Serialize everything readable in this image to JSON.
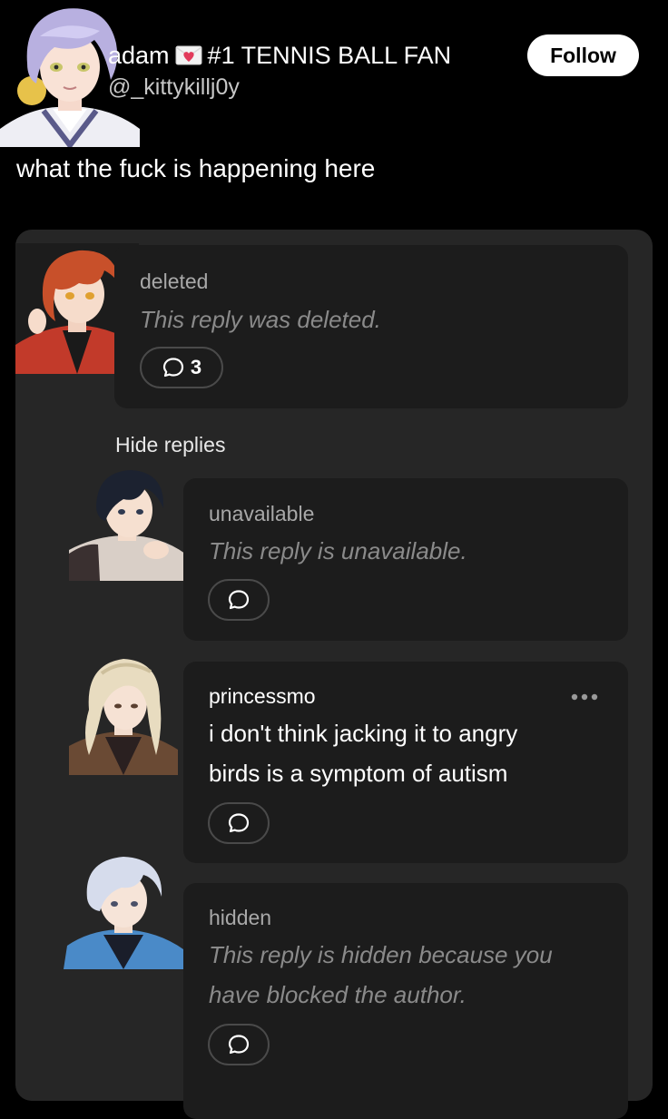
{
  "post": {
    "author_name": "adam",
    "author_badge_icon": "heart-envelope-icon",
    "author_tagline": "#1 TENNIS BALL FAN",
    "handle": "@_kittykillj0y",
    "follow_label": "Follow",
    "body": "what the fuck is happening here"
  },
  "thread": {
    "parent": {
      "username": "deleted",
      "message": "This reply was deleted.",
      "reply_count": "3"
    },
    "hide_replies_label": "Hide replies",
    "replies": [
      {
        "username": "unavailable",
        "message_lines": [
          "This reply is unavailable."
        ],
        "italic": true
      },
      {
        "username": "princessmo",
        "message_lines": [
          "i don't think jacking it to angry",
          "birds is a symptom of autism"
        ],
        "italic": false,
        "more_icon": "more-dots-icon"
      },
      {
        "username": "hidden",
        "message_lines": [
          "This reply is hidden because you",
          "have blocked the author."
        ],
        "italic": true
      }
    ]
  },
  "colors": {
    "background": "#000000",
    "panel": "#262626",
    "card": "#1c1c1c",
    "muted_text": "#8a8a8a",
    "follow_bg": "#ffffff"
  }
}
